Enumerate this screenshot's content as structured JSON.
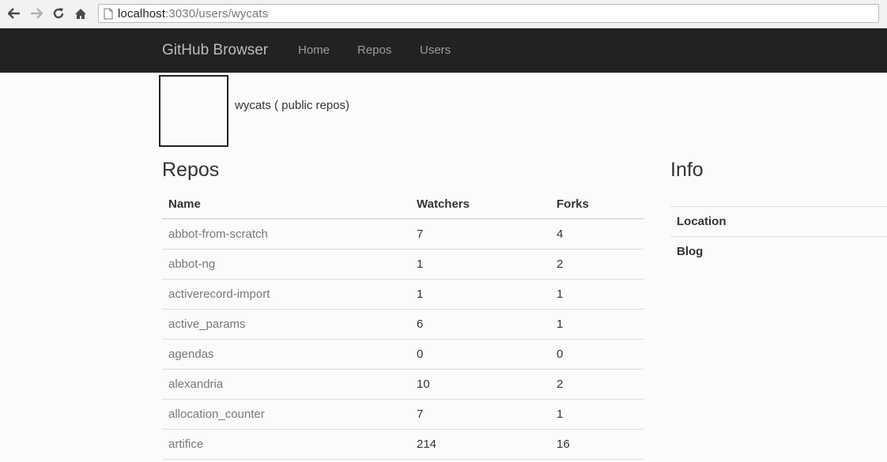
{
  "browser": {
    "url_host": "localhost",
    "url_rest": ":3030/users/wycats"
  },
  "navbar": {
    "brand": "GitHub Browser",
    "links": [
      "Home",
      "Repos",
      "Users"
    ]
  },
  "profile": {
    "name_line": "wycats ( public repos)"
  },
  "repos": {
    "title": "Repos",
    "columns": [
      "Name",
      "Watchers",
      "Forks"
    ],
    "rows": [
      {
        "name": "abbot-from-scratch",
        "watchers": "7",
        "forks": "4"
      },
      {
        "name": "abbot-ng",
        "watchers": "1",
        "forks": "2"
      },
      {
        "name": "activerecord-import",
        "watchers": "1",
        "forks": "1"
      },
      {
        "name": "active_params",
        "watchers": "6",
        "forks": "1"
      },
      {
        "name": "agendas",
        "watchers": "0",
        "forks": "0"
      },
      {
        "name": "alexandria",
        "watchers": "10",
        "forks": "2"
      },
      {
        "name": "allocation_counter",
        "watchers": "7",
        "forks": "1"
      },
      {
        "name": "artifice",
        "watchers": "214",
        "forks": "16"
      }
    ]
  },
  "info": {
    "title": "Info",
    "rows": [
      "Location",
      "Blog"
    ]
  }
}
